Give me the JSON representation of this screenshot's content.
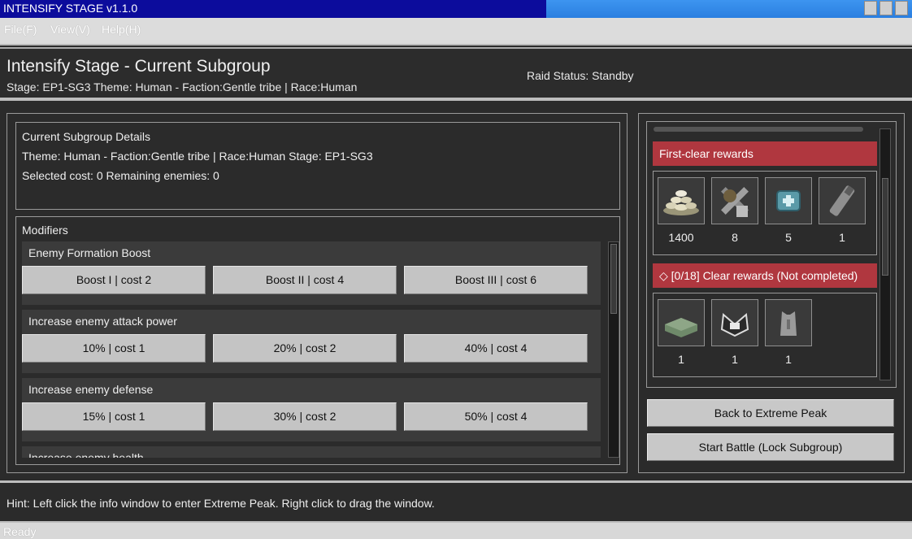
{
  "window": {
    "title": "INTENSIFY STAGE v1.1.0"
  },
  "menu": {
    "file": "File(F)",
    "view": "View(V)",
    "help": "Help(H)"
  },
  "header": {
    "title": "Intensify Stage - Current Subgroup",
    "stage_line": "Stage: EP1-SG3 Theme: Human - Faction:Gentle tribe | Race:Human",
    "raid_status": "Raid Status: Standby"
  },
  "details": {
    "heading": "Current Subgroup Details",
    "theme_line": "Theme: Human - Faction:Gentle tribe | Race:Human Stage: EP1-SG3",
    "cost_line": "Selected cost: 0 Remaining enemies: 0"
  },
  "modifiers": {
    "label": "Modifiers",
    "groups": [
      {
        "title": "Enemy Formation Boost",
        "options": [
          "Boost I | cost 2",
          "Boost II | cost 4",
          "Boost III | cost 6"
        ]
      },
      {
        "title": "Increase enemy attack power",
        "options": [
          "10% | cost 1",
          "20% | cost 2",
          "40% | cost 4"
        ]
      },
      {
        "title": "Increase enemy defense",
        "options": [
          "15% | cost 1",
          "30% | cost 2",
          "50% | cost 4"
        ]
      },
      {
        "title": "Increase enemy health",
        "options": [
          "",
          "",
          ""
        ]
      }
    ]
  },
  "rewards": {
    "first_clear": {
      "title": "First-clear rewards",
      "items": [
        {
          "icon": "coin-pile-icon",
          "count": "1400"
        },
        {
          "icon": "crossed-weapons-icon",
          "count": "8"
        },
        {
          "icon": "medkit-icon",
          "count": "5"
        },
        {
          "icon": "canister-icon",
          "count": "1"
        }
      ]
    },
    "clear": {
      "title": "◇ [0/18] Clear rewards (Not completed)",
      "items": [
        {
          "icon": "armor-plate-icon",
          "count": "1"
        },
        {
          "icon": "helmet-icon",
          "count": "1"
        },
        {
          "icon": "vest-icon",
          "count": "1"
        }
      ]
    }
  },
  "actions": {
    "back": "Back to Extreme Peak",
    "start": "Start Battle (Lock Subgroup)"
  },
  "hint": "Hint: Left click the info window to enter Extreme Peak. Right click to drag the window.",
  "status": "Ready",
  "colors": {
    "reward_header": "#b0373f",
    "title_bar": "#0c0c9c",
    "panel_bg": "#2b2b2b"
  }
}
